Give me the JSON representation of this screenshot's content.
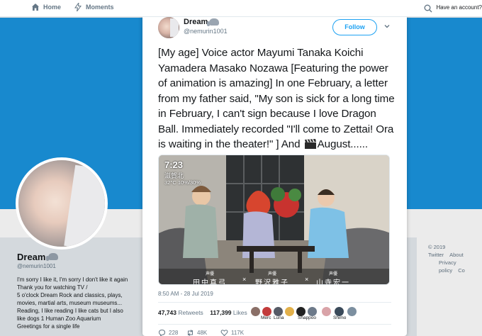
{
  "nav": {
    "home": "Home",
    "moments": "Moments",
    "account": "Have an account?"
  },
  "profile": {
    "name": "Dream",
    "handle": "@nemurin1001",
    "bio_lines": [
      "I'm sorry I like it, I'm sorry I don't like it again",
      "Thank you for watching TV /",
      "5 o'clock Dream Rock and classics, plays,",
      "movies, martial arts, museum museums...",
      "Reading, I like reading I like cats but I also",
      "like dogs 1 Human Zoo Aquarium",
      "Greetings for a single life"
    ]
  },
  "footer": {
    "copyright": "© 2019 Twitter",
    "about": "About",
    "privacy": "Privacy policy",
    "cookies": "Co"
  },
  "tweet": {
    "author_name": "Dream",
    "author_handle": "@nemurin1001",
    "follow_label": "Follow",
    "text_before_emoji": "[My age] Voice actor Mayumi Tanaka Koichi Yamadera Masako Nozawa [Featuring the power of animation is amazing] In one February, a letter from my father said, \"My son is sick for a long time in February, I can't sign because I love Dragon Ball. Immediately recorded \"I'll come to Zettai! Ora is waiting in the theater!\" ] And",
    "text_after_emoji": "August......",
    "media": {
      "clock": "7:23",
      "channel": "滋賀北",
      "temp": "32°C 10%/30%",
      "captions": [
        {
          "role": "声優",
          "name": "田中真弓"
        },
        {
          "role": "声優",
          "name": "野沢雅子"
        },
        {
          "role": "声優",
          "name": "山寺宏一"
        }
      ],
      "separator": "×"
    },
    "timestamp": "8:50 AM - 28 Jul 2019",
    "retweets_count": "47,743",
    "retweets_label": "Retweets",
    "likes_count": "117,399",
    "likes_label": "Likes",
    "likers": [
      {
        "label": "",
        "color": "#8a6f67"
      },
      {
        "label": "",
        "color": "#c23b3b"
      },
      {
        "label": "Merc",
        "color": "#555a66"
      },
      {
        "label": "Luna",
        "color": "#e2b04a"
      },
      {
        "label": "",
        "color": "#222222"
      },
      {
        "label": "Shappoo",
        "color": "#6d7a8a"
      },
      {
        "label": "",
        "color": "#d9a3a8"
      },
      {
        "label": "Shimo",
        "color": "#3a4a5a"
      },
      {
        "label": "",
        "color": "#7c8fa0"
      }
    ],
    "actions": {
      "reply": "228",
      "retweet": "48K",
      "like": "117K"
    }
  },
  "colors": {
    "banner": "#1b95e0",
    "accent": "#1da1f2",
    "muted": "#657786"
  }
}
